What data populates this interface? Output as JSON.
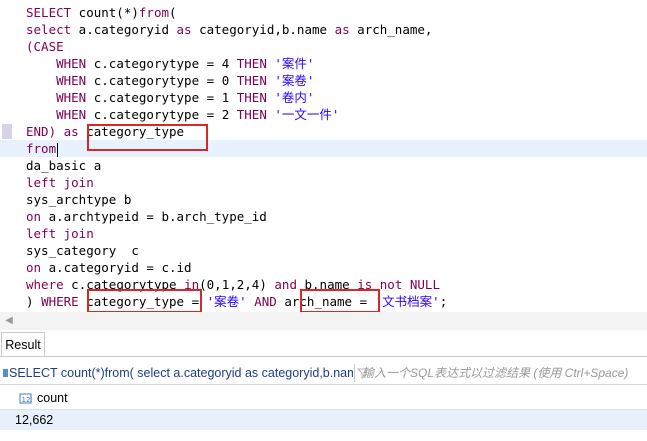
{
  "editor": {
    "lines": [
      [
        {
          "t": "SELECT",
          "c": "kw"
        },
        {
          "t": " count(*)"
        },
        {
          "t": "from",
          "c": "kw"
        },
        {
          "t": "("
        }
      ],
      [
        {
          "t": "select",
          "c": "kw"
        },
        {
          "t": " a.categoryid "
        },
        {
          "t": "as",
          "c": "kw"
        },
        {
          "t": " categoryid,b.name "
        },
        {
          "t": "as",
          "c": "kw"
        },
        {
          "t": " arch_name,"
        }
      ],
      [
        {
          "t": "(CASE",
          "c": "kw"
        }
      ],
      [
        {
          "t": "    "
        },
        {
          "t": "WHEN",
          "c": "kw"
        },
        {
          "t": " c.categorytype = "
        },
        {
          "t": "4",
          "c": "num"
        },
        {
          "t": " "
        },
        {
          "t": "THEN",
          "c": "kw"
        },
        {
          "t": " "
        },
        {
          "t": "'案件'",
          "c": "str"
        }
      ],
      [
        {
          "t": "    "
        },
        {
          "t": "WHEN",
          "c": "kw"
        },
        {
          "t": " c.categorytype = "
        },
        {
          "t": "0",
          "c": "num"
        },
        {
          "t": " "
        },
        {
          "t": "THEN",
          "c": "kw"
        },
        {
          "t": " "
        },
        {
          "t": "'案卷'",
          "c": "str"
        }
      ],
      [
        {
          "t": "    "
        },
        {
          "t": "WHEN",
          "c": "kw"
        },
        {
          "t": " c.categorytype = "
        },
        {
          "t": "1",
          "c": "num"
        },
        {
          "t": " "
        },
        {
          "t": "THEN",
          "c": "kw"
        },
        {
          "t": " "
        },
        {
          "t": "'卷内'",
          "c": "str"
        }
      ],
      [
        {
          "t": "    "
        },
        {
          "t": "WHEN",
          "c": "kw"
        },
        {
          "t": " c.categorytype = "
        },
        {
          "t": "2",
          "c": "num"
        },
        {
          "t": " "
        },
        {
          "t": "THEN",
          "c": "kw"
        },
        {
          "t": " "
        },
        {
          "t": "'一文一件'",
          "c": "str"
        }
      ],
      [
        {
          "t": "END)",
          "c": "kw"
        },
        {
          "t": " "
        },
        {
          "t": "as",
          "c": "kw"
        },
        {
          "t": " category_type"
        }
      ],
      [
        {
          "t": "from",
          "c": "kw"
        }
      ],
      [
        {
          "t": "da_basic a"
        }
      ],
      [
        {
          "t": "left join",
          "c": "kw"
        }
      ],
      [
        {
          "t": "sys_archtype b"
        }
      ],
      [
        {
          "t": "on",
          "c": "kw"
        },
        {
          "t": " a.archtypeid = b.arch_type_id"
        }
      ],
      [
        {
          "t": "left join",
          "c": "kw"
        }
      ],
      [
        {
          "t": "sys_category  c"
        }
      ],
      [
        {
          "t": "on",
          "c": "kw"
        },
        {
          "t": " a.categoryid = c.id"
        }
      ],
      [
        {
          "t": "where",
          "c": "kw"
        },
        {
          "t": " c.categorytype "
        },
        {
          "t": "in",
          "c": "kw"
        },
        {
          "t": "(0,1,2,4) "
        },
        {
          "t": "and",
          "c": "kw"
        },
        {
          "t": " b.name "
        },
        {
          "t": "is not NULL",
          "c": "kw"
        }
      ],
      [
        {
          "t": ") "
        },
        {
          "t": "WHERE",
          "c": "kw"
        },
        {
          "t": " category_type = "
        },
        {
          "t": "'案卷'",
          "c": "str"
        },
        {
          "t": " "
        },
        {
          "t": "AND",
          "c": "kw"
        },
        {
          "t": " arch_name = "
        },
        {
          "t": "'文书档案'",
          "c": "str"
        },
        {
          "t": ";"
        }
      ]
    ]
  },
  "results": {
    "tab_label": "Result",
    "query_preview": "SELECT count(*)from( select a.categoryid as categoryid,b.name as arch_name,",
    "filter_placeholder": "输入一个SQL表达式以过滤结果 (使用 Ctrl+Space)",
    "column_name": "count",
    "row_value": "12,662"
  },
  "colors": {
    "highlight_box": "#d9262b",
    "keyword": "#7f0055",
    "string": "#2a00ff",
    "selected_row": "#e8f0fb"
  }
}
